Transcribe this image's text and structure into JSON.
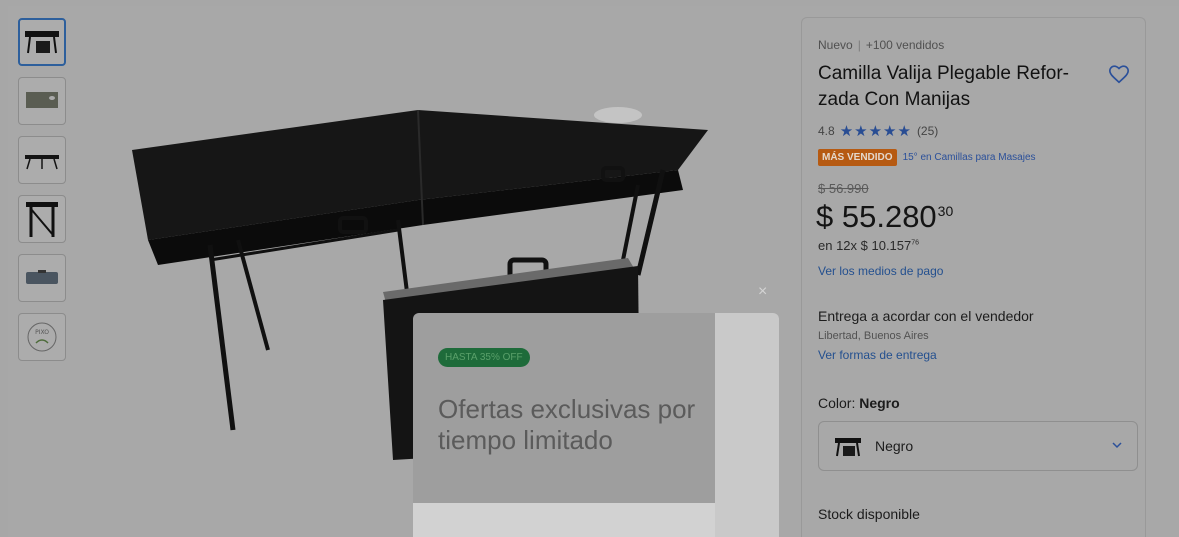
{
  "thumbnails": [
    {
      "icon": "massage-table-thumb",
      "active": true
    },
    {
      "icon": "table-top-thumb",
      "active": false
    },
    {
      "icon": "table-side-thumb",
      "active": false
    },
    {
      "icon": "table-end-thumb",
      "active": false
    },
    {
      "icon": "case-thumb",
      "active": false
    },
    {
      "icon": "logo-thumb",
      "active": false
    }
  ],
  "logo_thumb_text": "PIXO",
  "product": {
    "condition": "Nuevo",
    "sold": "+100 vendidos",
    "title": "Camilla Valija Plegable Refor- zada Con Manijas",
    "rating": "4.8",
    "stars": "★★★★★",
    "reviews": "(25)",
    "badge": "MÁS VENDIDO",
    "rank": "15° en Camillas para Masajes",
    "old_price": "$ 56.990",
    "price_main": "$ 55.280",
    "price_cents": "30",
    "installments_prefix": "en 12x $ 10.157",
    "installments_cents": "76",
    "payment_link": "Ver los medios de pago",
    "delivery": "Entrega a acordar con el vendedor",
    "location": "Libertad, Buenos Aires",
    "delivery_link": "Ver formas de entrega",
    "color_label": "Color: ",
    "color_value": "Negro",
    "selected_color": "Negro",
    "stock": "Stock disponible"
  },
  "promo": {
    "close": "×",
    "badge": "HASTA 35% OFF",
    "text": "Ofertas exclusivas por tiempo limitado"
  },
  "colors": {
    "link": "#24508f",
    "star": "#294d93",
    "badge_bg": "#b65a12",
    "promo_badge_bg": "#1e6b3a"
  }
}
